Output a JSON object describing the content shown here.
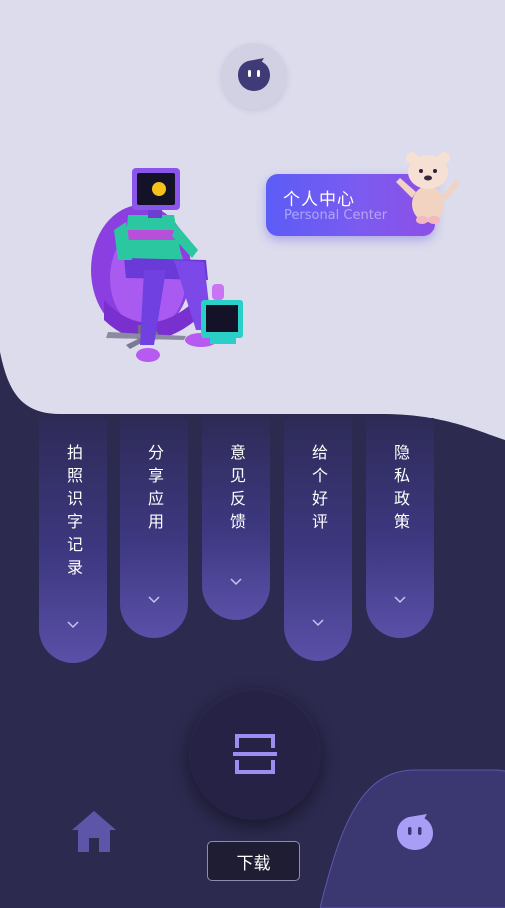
{
  "colors": {
    "top_background": "#dcdced",
    "bottom_background": "#2c2a4f",
    "accent_purple": "#6b5cf0",
    "menu_gradient_end": "#5a50a8",
    "scan_icon": "#9b8ef0"
  },
  "header": {
    "avatar_icon": "chat-face-icon"
  },
  "personal_center": {
    "title": "个人中心",
    "subtitle": "Personal Center"
  },
  "menu": {
    "items": [
      {
        "label": "拍照识字记录",
        "icon": "chevron-down-icon"
      },
      {
        "label": "分享应用",
        "icon": "chevron-down-icon"
      },
      {
        "label": "意见反馈",
        "icon": "chevron-down-icon"
      },
      {
        "label": "给个好评",
        "icon": "chevron-down-icon"
      },
      {
        "label": "隐私政策",
        "icon": "chevron-down-icon"
      }
    ]
  },
  "bottom_nav": {
    "scan_icon": "scan-icon",
    "home_icon": "home-icon",
    "profile_icon": "chat-face-icon",
    "download_label": "下载"
  }
}
